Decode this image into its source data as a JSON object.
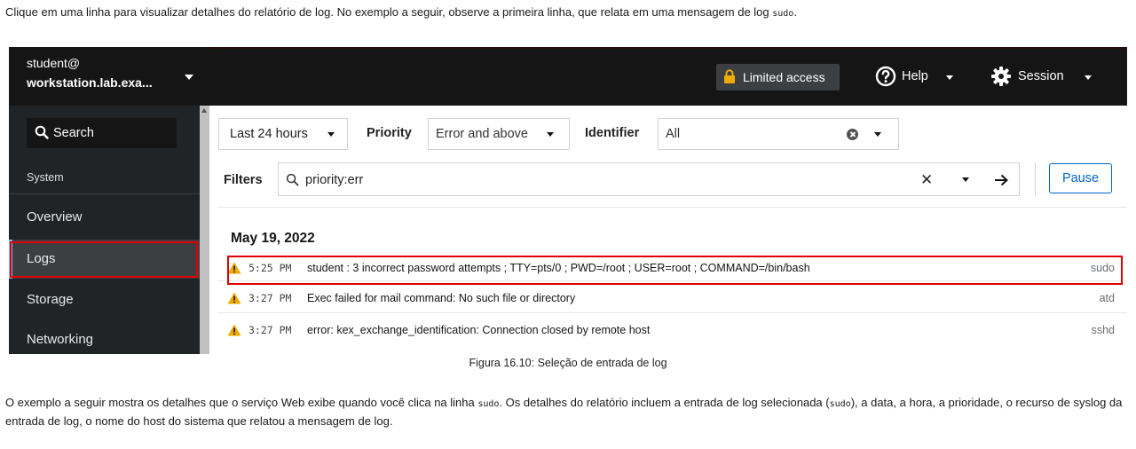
{
  "document": {
    "intro_before": "Clique em uma linha para visualizar detalhes do relatório de log. No exemplo a seguir, observe a primeira linha, que relata em uma mensagem de log ",
    "intro_code": "sudo",
    "intro_after": ".",
    "caption": "Figura 16.10: Seleção de entrada de log",
    "para2_a": "O exemplo a seguir mostra os detalhes que o serviço Web exibe quando você clica na linha ",
    "para2_code1": "sudo",
    "para2_b": ". Os detalhes do relatório incluem a entrada de log selecionada (",
    "para2_code2": "sudo",
    "para2_c": "), a data, a hora, a prioridade, o recurso de syslog da entrada de log, o nome do host do sistema que relatou a mensagem de log."
  },
  "sidebar": {
    "host_user": "student@",
    "host_name": "workstation.lab.exa...",
    "search_label": "Search",
    "section_label": "System",
    "items": [
      {
        "label": "Overview"
      },
      {
        "label": "Logs"
      },
      {
        "label": "Storage"
      },
      {
        "label": "Networking"
      }
    ]
  },
  "topbar": {
    "limited_access": "Limited access",
    "help": "Help",
    "session": "Session"
  },
  "filters": {
    "time_range": "Last 24 hours",
    "priority_label": "Priority",
    "priority_value": "Error and above",
    "identifier_label": "Identifier",
    "identifier_value": "All",
    "filters_label": "Filters",
    "filter_text": "priority:err",
    "clear_glyph": "✕",
    "pause": "Pause"
  },
  "logs": {
    "date_heading": "May 19, 2022",
    "entries": [
      {
        "time": "5:25 PM",
        "message": "student : 3 incorrect password attempts ; TTY=pts/0 ; PWD=/root ; USER=root ; COMMAND=/bin/bash",
        "source": "sudo"
      },
      {
        "time": "3:27 PM",
        "message": "Exec failed for mail command: No such file or directory",
        "source": "atd"
      },
      {
        "time": "3:27 PM",
        "message": "error: kex_exchange_identification: Connection closed by remote host",
        "source": "sshd"
      }
    ]
  },
  "colors": {
    "highlight_red": "#e00000",
    "warning_yellow": "#f0ab00",
    "link_blue": "#0066cc",
    "nav_active_accent": "#73bcf7"
  },
  "icons": {
    "search": "search-icon",
    "lock": "lock-icon",
    "help": "help-circle-icon",
    "session": "gear-icon",
    "warning": "warning-icon",
    "arrow": "arrow-right-icon"
  }
}
